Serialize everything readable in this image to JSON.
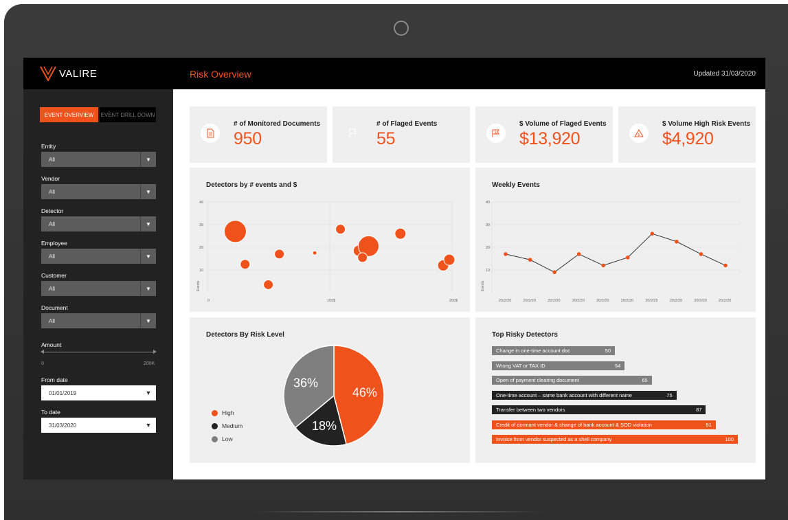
{
  "app": {
    "brand": "VALIRE",
    "title": "Risk Overview",
    "updated": "Updated 31/03/2020"
  },
  "sidebar": {
    "tabs": [
      {
        "label": "EVENT OVERVIEW"
      },
      {
        "label": "EVENT DRILL DOWN"
      }
    ],
    "filters": [
      {
        "label": "Entity",
        "value": "All"
      },
      {
        "label": "Vendor",
        "value": "All"
      },
      {
        "label": "Detector",
        "value": "All"
      },
      {
        "label": "Employee",
        "value": "All"
      },
      {
        "label": "Customer",
        "value": "All"
      },
      {
        "label": "Document",
        "value": "All"
      }
    ],
    "amount": {
      "label": "Amount",
      "min": "0",
      "max": "200K"
    },
    "from_date": {
      "label": "From date",
      "value": "01/01/2019"
    },
    "to_date": {
      "label": "To date",
      "value": "31/03/2020"
    }
  },
  "kpis": [
    {
      "label": "# of Monitored Documents",
      "value": "950",
      "icon": "document-icon"
    },
    {
      "label": "# of Flaged Events",
      "value": "55",
      "icon": "flag-icon"
    },
    {
      "label": "$ Volume of Flaged Events",
      "value": "$13,920",
      "icon": "flag-dollar-icon"
    },
    {
      "label": "$ Volume High Risk Events",
      "value": "$4,920",
      "icon": "warning-icon"
    }
  ],
  "colors": {
    "accent": "#f0521c",
    "dark": "#222222",
    "gray": "#7f7f7f"
  },
  "chart_data": [
    {
      "type": "scatter",
      "title": "Detectors by # events and $",
      "ylabel": "Events",
      "xlim": [
        0,
        200
      ],
      "ylim": [
        0,
        40
      ],
      "x_ticks": [
        "0",
        "100$",
        "200$"
      ],
      "y_ticks": [
        "10",
        "20",
        "30",
        "40"
      ],
      "grid": true,
      "points": [
        {
          "x": 25,
          "y": 27,
          "size": 16
        },
        {
          "x": 33,
          "y": 12.5,
          "size": 7
        },
        {
          "x": 52,
          "y": 3.5,
          "size": 7
        },
        {
          "x": 61,
          "y": 17,
          "size": 7
        },
        {
          "x": 90,
          "y": 17.5,
          "size": 3
        },
        {
          "x": 111,
          "y": 28,
          "size": 7
        },
        {
          "x": 126,
          "y": 18.5,
          "size": 8
        },
        {
          "x": 134,
          "y": 20.5,
          "size": 15
        },
        {
          "x": 129,
          "y": 15.5,
          "size": 7
        },
        {
          "x": 160,
          "y": 26,
          "size": 8
        },
        {
          "x": 195,
          "y": 12,
          "size": 8
        },
        {
          "x": 200,
          "y": 14.5,
          "size": 8
        }
      ]
    },
    {
      "type": "line",
      "title": "Weekly Events",
      "ylabel": "Events",
      "ylim": [
        0,
        40
      ],
      "y_ticks": [
        "10",
        "20",
        "30",
        "40"
      ],
      "grid": true,
      "categories": [
        "20/2/20",
        "20/2/20",
        "20/2/20",
        "20/2/20",
        "20/2/20",
        "20/2/20",
        "20/2/20",
        "20/2/20",
        "20/2/20",
        "20/2/20"
      ],
      "values": [
        17,
        14.5,
        9,
        17,
        12,
        15.5,
        26,
        22.5,
        17,
        12
      ]
    },
    {
      "type": "pie",
      "title": "Detectors By Risk Level",
      "legend_position": "left",
      "slices": [
        {
          "name": "High",
          "value": 46,
          "label": "46%",
          "color": "#f0521c"
        },
        {
          "name": "Medium",
          "value": 18,
          "label": "18%",
          "color": "#222222"
        },
        {
          "name": "Low",
          "value": 36,
          "label": "36%",
          "color": "#7f7f7f"
        }
      ]
    },
    {
      "type": "bar",
      "orientation": "horizontal",
      "title": "Top Risky Detectors",
      "categories": [
        "Change in one-time account doc",
        "Wrong VAT or TAX ID",
        "Open of payment clearing document",
        "One-time account – same bank account with different name",
        "Transfer between two vendors",
        "Credit of dormant vendor & change of bank account & SOD violation",
        "Invoice from vendor suspected as a shell company"
      ],
      "values": [
        50,
        54,
        65,
        75,
        87,
        91,
        100
      ],
      "colors": [
        "#7f7f7f",
        "#7f7f7f",
        "#7f7f7f",
        "#222222",
        "#222222",
        "#f0521c",
        "#f0521c"
      ]
    }
  ]
}
